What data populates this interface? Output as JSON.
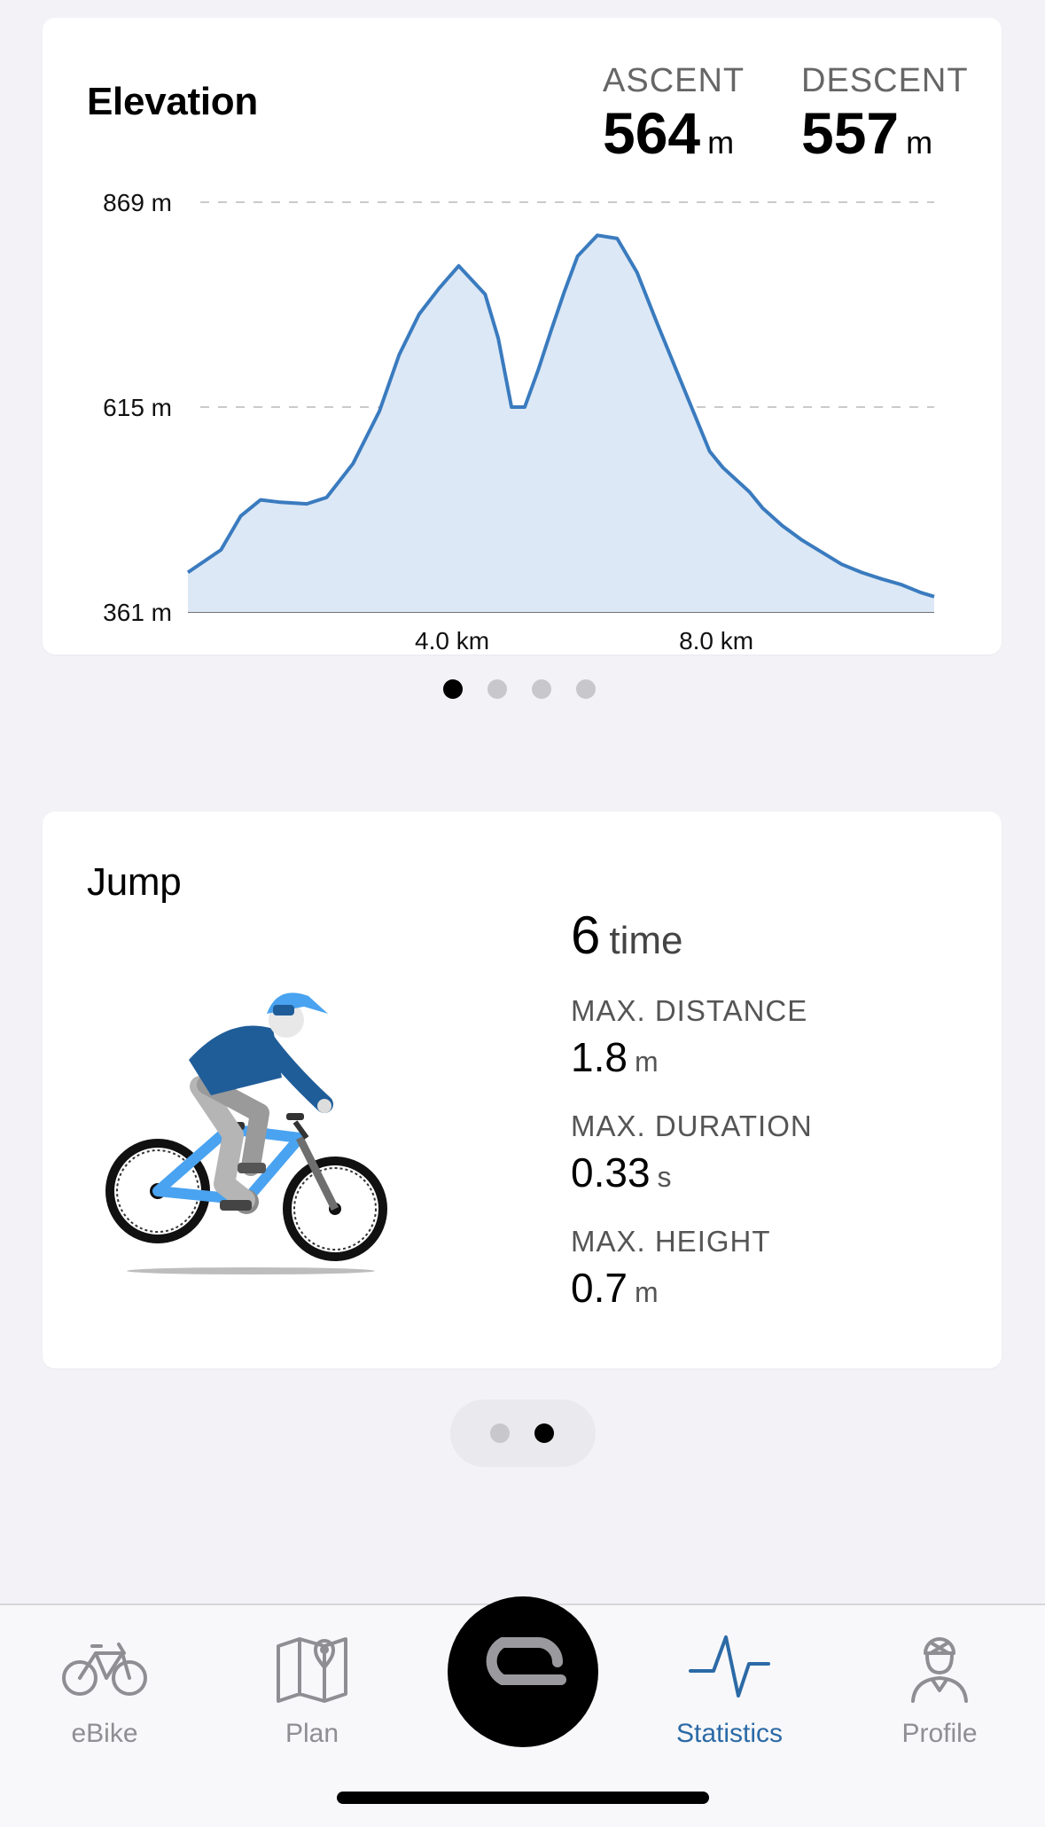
{
  "elevation": {
    "title": "Elevation",
    "ascent_label": "ASCENT",
    "ascent_value": "564",
    "ascent_unit": "m",
    "descent_label": "DESCENT",
    "descent_value": "557",
    "descent_unit": "m",
    "pager": {
      "count": 4,
      "active": 0
    }
  },
  "chart_data": {
    "type": "area",
    "title": "Elevation",
    "xlabel": "",
    "ylabel": "",
    "ylim": [
      361,
      869
    ],
    "xlim": [
      0,
      11.3
    ],
    "y_ticks": [
      "869 m",
      "615 m",
      "361 m"
    ],
    "y_tick_values": [
      869,
      615,
      361
    ],
    "x_ticks": [
      "4.0 km",
      "8.0 km"
    ],
    "x_tick_values": [
      4.0,
      8.0
    ],
    "grid": true,
    "color": "#3a7bbf",
    "fill": "#dce8f5",
    "series": [
      {
        "x": [
          0,
          0.5,
          0.8,
          1.1,
          1.4,
          1.8,
          2.1,
          2.5,
          2.9,
          3.2,
          3.5,
          3.8,
          4.1,
          4.5,
          4.7,
          4.9,
          5.1,
          5.3,
          5.5,
          5.7,
          5.9,
          6.2,
          6.5,
          6.8,
          7.1,
          7.3,
          7.6,
          7.9,
          8.1,
          8.3,
          8.5,
          8.7,
          9.0,
          9.3,
          9.6,
          9.9,
          10.2,
          10.5,
          10.8,
          11.1,
          11.3
        ],
        "y": [
          410,
          438,
          480,
          500,
          497,
          495,
          503,
          545,
          610,
          680,
          730,
          762,
          790,
          755,
          700,
          615,
          615,
          660,
          710,
          758,
          802,
          828,
          824,
          782,
          720,
          680,
          620,
          560,
          540,
          525,
          510,
          490,
          468,
          450,
          435,
          420,
          410,
          402,
          395,
          385,
          380
        ]
      }
    ]
  },
  "jump": {
    "title": "Jump",
    "count_value": "6",
    "count_unit": "time",
    "max_distance_label": "MAX. DISTANCE",
    "max_distance_value": "1.8",
    "max_distance_unit": "m",
    "max_duration_label": "MAX. DURATION",
    "max_duration_value": "0.33",
    "max_duration_unit": "s",
    "max_height_label": "MAX. HEIGHT",
    "max_height_value": "0.7",
    "max_height_unit": "m",
    "pager": {
      "count": 2,
      "active": 1
    }
  },
  "tabbar": {
    "tabs": [
      {
        "label": "eBike",
        "icon": "bike-icon",
        "active": false
      },
      {
        "label": "Plan",
        "icon": "map-pin-icon",
        "active": false
      },
      {
        "label": "Statistics",
        "icon": "pulse-icon",
        "active": true
      },
      {
        "label": "Profile",
        "icon": "rider-icon",
        "active": false
      }
    ],
    "active_color": "#2c6aa6",
    "inactive_color": "#8e8e93"
  }
}
